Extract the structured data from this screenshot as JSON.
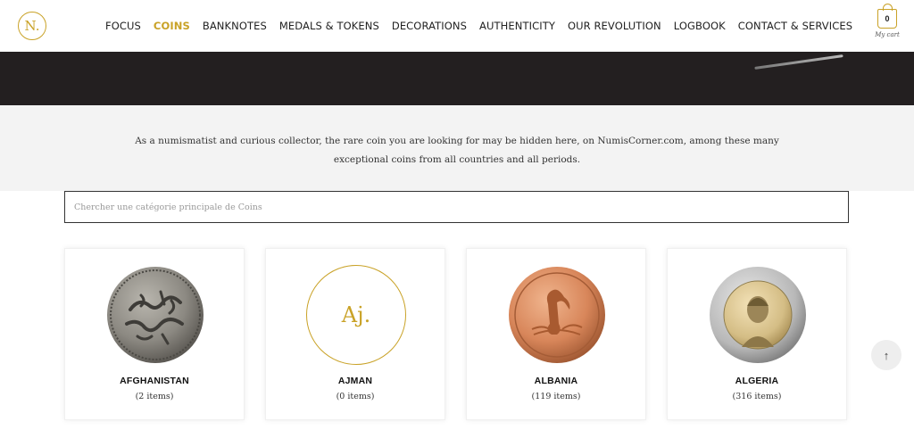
{
  "header": {
    "logo_text": "N.",
    "nav": [
      {
        "label": "FOCUS",
        "active": false
      },
      {
        "label": "COINS",
        "active": true
      },
      {
        "label": "BANKNOTES",
        "active": false
      },
      {
        "label": "MEDALS & TOKENS",
        "active": false
      },
      {
        "label": "DECORATIONS",
        "active": false
      },
      {
        "label": "AUTHENTICITY",
        "active": false
      },
      {
        "label": "OUR REVOLUTION",
        "active": false
      },
      {
        "label": "LOGBOOK",
        "active": false
      },
      {
        "label": "CONTACT & SERVICES",
        "active": false
      }
    ],
    "cart": {
      "count": "0",
      "label": "My cart",
      "icon": "shopping-bag-icon"
    }
  },
  "intro": {
    "text": "As a numismatist and curious collector, the rare coin you are looking for may be hidden here, on NumisCorner.com, among these many exceptional coins from all countries and all periods."
  },
  "search": {
    "placeholder": "Chercher une catégorie principale de Coins",
    "value": ""
  },
  "categories": [
    {
      "name": "AFGHANISTAN",
      "count": "(2 items)",
      "image": "silver-coin-arabic-script"
    },
    {
      "name": "AJMAN",
      "count": "(0 items)",
      "image": "placeholder",
      "placeholder_text": "Aj."
    },
    {
      "name": "ALBANIA",
      "count": "(119 items)",
      "image": "bronze-coin-pelican"
    },
    {
      "name": "ALGERIA",
      "count": "(316 items)",
      "image": "bimetal-coin-portrait"
    }
  ],
  "colors": {
    "accent": "#c9a227",
    "banner": "#231f20",
    "intro_bg": "#f3f3f3"
  },
  "scroll_top": {
    "icon": "arrow-up-icon",
    "label": "↑"
  }
}
